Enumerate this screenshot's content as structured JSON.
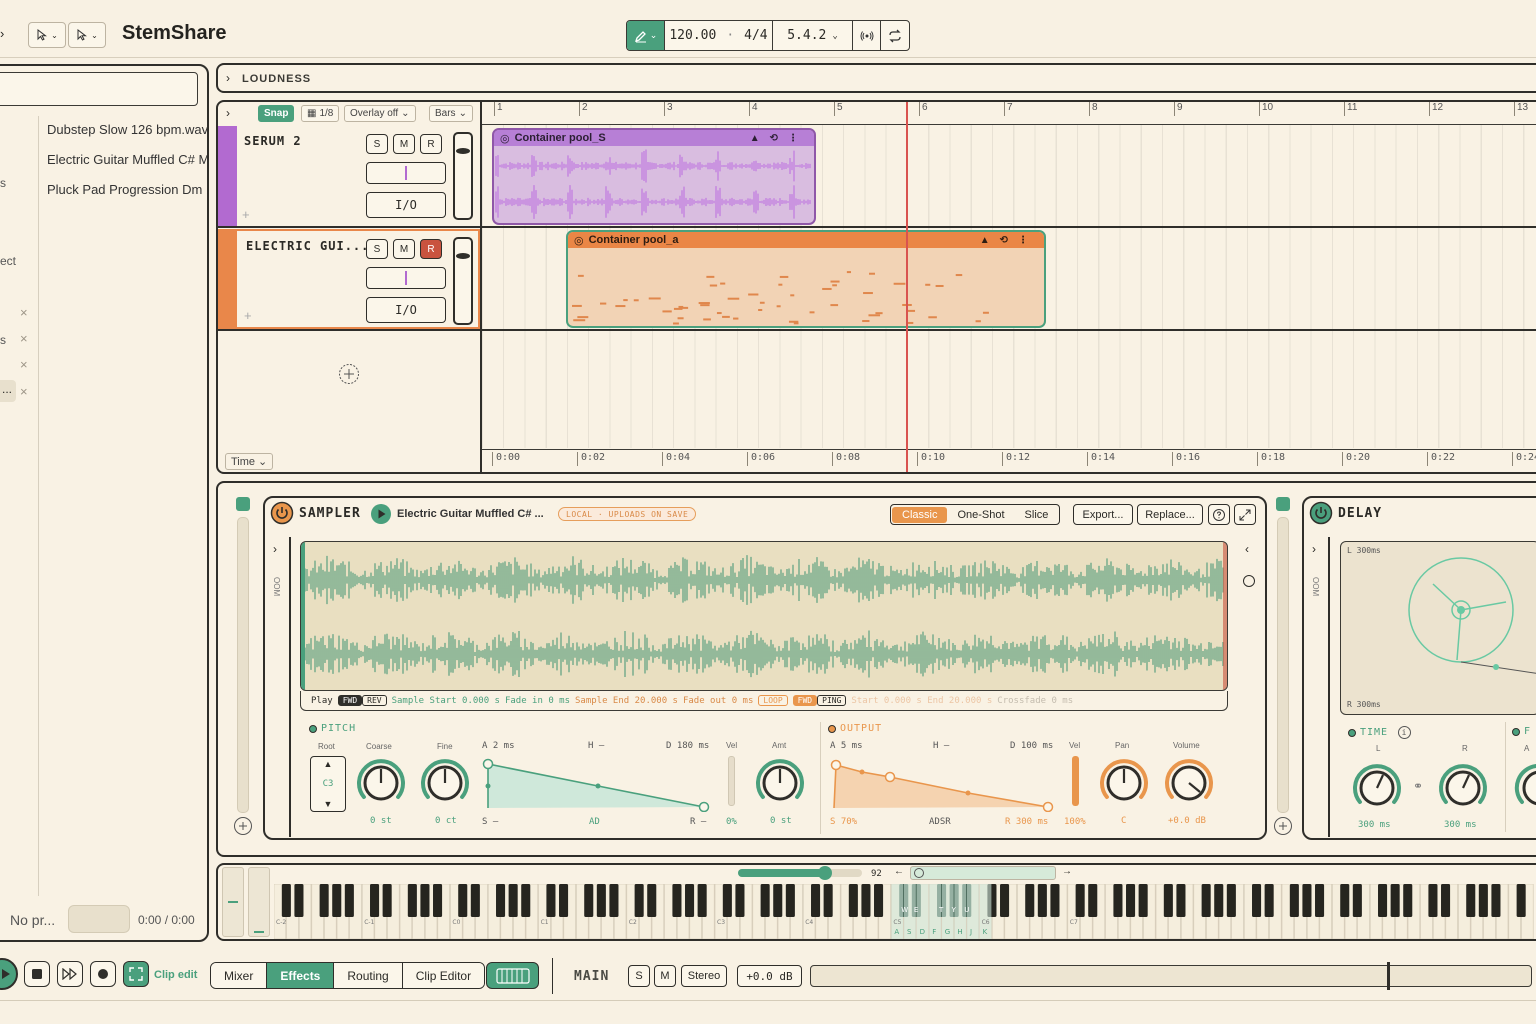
{
  "header": {
    "title": "StemShare",
    "tempo": "120.00",
    "time_signature": "4/4",
    "position": "5.4.2"
  },
  "browser": {
    "files": [
      "Dubstep Slow 126 bpm.wav",
      "Electric Guitar Muffled C# M",
      "Pluck Pad Progression Dm 1"
    ],
    "fragments": [
      "s",
      "ect",
      "s",
      "..."
    ],
    "close_glyph": "×",
    "now_playing_label": "No pr...",
    "now_playing_time": "0:00 / 0:00"
  },
  "arrange": {
    "loudness_label": "LOUDNESS",
    "snap_label": "Snap",
    "grid_label": "1/8",
    "overlay_label": "Overlay off",
    "bars_label": "Bars",
    "time_label": "Time",
    "bar_numbers": [
      "1",
      "2",
      "3",
      "4",
      "5",
      "6",
      "7",
      "8",
      "9",
      "10",
      "11",
      "12",
      "13"
    ],
    "time_labels": [
      "0:00",
      "0:02",
      "0:04",
      "0:06",
      "0:08",
      "0:10",
      "0:12",
      "0:14",
      "0:16",
      "0:18",
      "0:20",
      "0:22",
      "0:24"
    ],
    "tracks": [
      {
        "name": "SERUM 2",
        "color": "#b26ad0",
        "s": "S",
        "m": "M",
        "r": "R",
        "io": "I/O",
        "armed": false
      },
      {
        "name": "ELECTRIC GUI...",
        "color": "#e9874a",
        "s": "S",
        "m": "M",
        "r": "R",
        "io": "I/O",
        "armed": true
      }
    ],
    "clips": [
      {
        "name": "Container pool_S",
        "color": "#b77fd6"
      },
      {
        "name": "Container pool_a",
        "color": "#ea8646"
      }
    ]
  },
  "sampler": {
    "title": "SAMPLER",
    "file": "Electric Guitar Muffled C# ...",
    "badge": "LOCAL · UPLOADS ON SAVE",
    "modes": [
      "Classic",
      "One-Shot",
      "Slice"
    ],
    "active_mode": "Classic",
    "export_label": "Export...",
    "replace_label": "Replace...",
    "side_label": "OOM",
    "play_row": {
      "play": "Play",
      "fwd": "FWD",
      "rev": "REV",
      "sample_start": "Sample Start 0.000 s",
      "fade_in": "Fade in 0 ms",
      "sample_end": "Sample End 20.000 s",
      "fade_out": "Fade out 0 ms",
      "loop": "LOOP",
      "fwd2": "FWD",
      "ping": "PING",
      "loop_info": "Start 0.000 s  End 20.000 s",
      "crossfade": "Crossfade 0 ms"
    },
    "pitch": {
      "label": "PITCH",
      "root_label": "Root",
      "root_value": "C3",
      "coarse_label": "Coarse",
      "coarse_value": "0 st",
      "fine_label": "Fine",
      "fine_value": "0 ct",
      "env_a": "A 2 ms",
      "env_h": "H –",
      "env_d": "D 180 ms",
      "env_s": "S –",
      "env_type": "AD",
      "env_r": "R –",
      "vel_label": "Vel",
      "vel_value": "0%",
      "amt_label": "Amt",
      "amt_value": "0 st"
    },
    "output": {
      "label": "OUTPUT",
      "env_a": "A 5 ms",
      "env_h": "H –",
      "env_d": "D 100 ms",
      "env_s": "S 70%",
      "env_type": "ADSR",
      "env_r": "R 300 ms",
      "vel_label": "Vel",
      "vel_value": "100%",
      "pan_label": "Pan",
      "pan_value": "C",
      "volume_label": "Volume",
      "volume_value": "+0.0 dB"
    }
  },
  "delay": {
    "title": "DELAY",
    "side_label": "OOM",
    "screen_top": "L 300ms",
    "screen_bottom": "R 300ms",
    "time_label": "TIME",
    "l_label": "L",
    "r_label": "R",
    "l_value": "300 ms",
    "r_value": "300 ms",
    "next_label": "F",
    "next_sub": "A"
  },
  "keyboard": {
    "velocity": "92",
    "octave_labels": [
      "C-2",
      "C-1",
      "C0",
      "C1",
      "C2",
      "C3",
      "C4",
      "C5",
      "C6",
      "C7"
    ],
    "black_key_letters": [
      "W",
      "E",
      "T",
      "Y",
      "U"
    ],
    "white_key_letters": [
      "A",
      "S",
      "D",
      "F",
      "G",
      "H",
      "J",
      "K"
    ]
  },
  "transport": {
    "clip_edit": "Clip edit",
    "tabs": [
      "Mixer",
      "Effects",
      "Routing",
      "Clip Editor"
    ],
    "active_tab": "Effects",
    "main_label": "MAIN",
    "s": "S",
    "m": "M",
    "stereo": "Stereo",
    "gain": "+0.0 dB"
  },
  "colors": {
    "accent_green": "#4aa07d",
    "accent_orange": "#e9964c",
    "accent_purple": "#b26ad0",
    "playhead": "#d9534f"
  }
}
